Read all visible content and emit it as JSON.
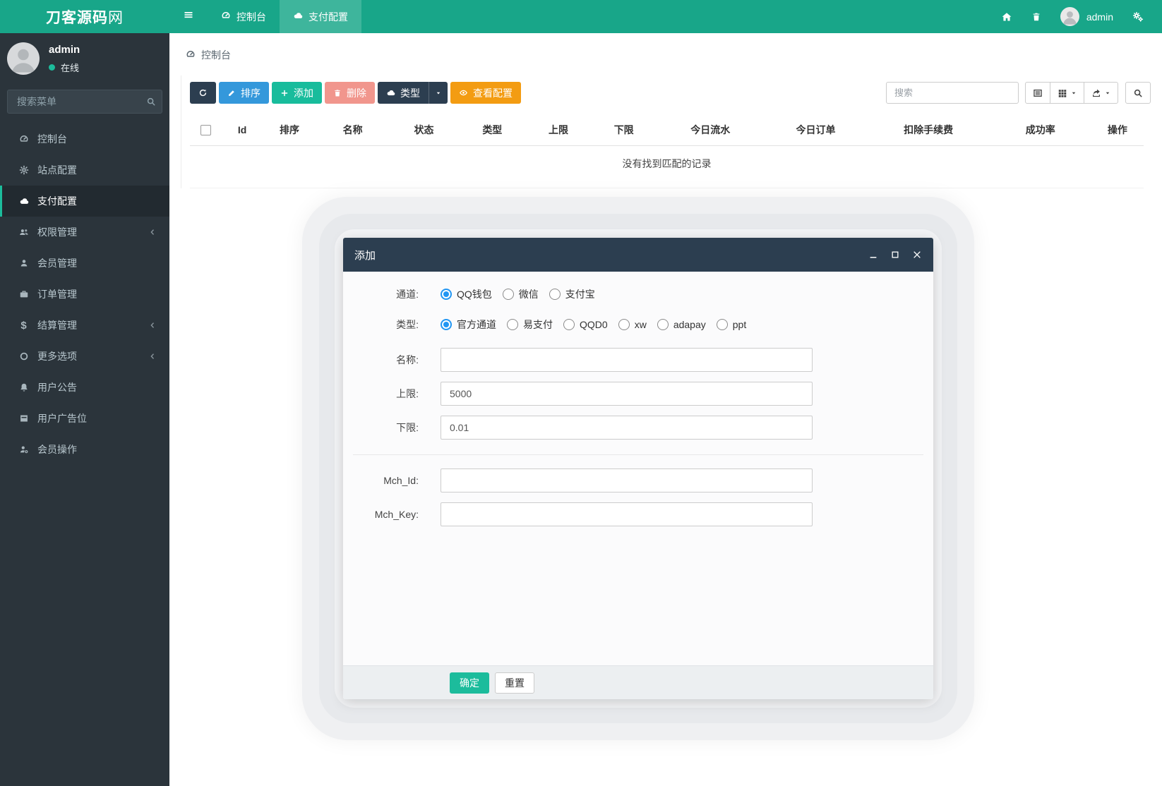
{
  "navbar": {
    "brand_bold": "刀客源码",
    "brand_light": "网",
    "tabs": [
      {
        "label": "控制台"
      },
      {
        "label": "支付配置"
      }
    ],
    "username": "admin"
  },
  "sidebar": {
    "username": "admin",
    "status": "在线",
    "search_placeholder": "搜索菜单",
    "items": [
      {
        "label": "控制台"
      },
      {
        "label": "站点配置"
      },
      {
        "label": "支付配置"
      },
      {
        "label": "权限管理"
      },
      {
        "label": "会员管理"
      },
      {
        "label": "订单管理"
      },
      {
        "label": "结算管理"
      },
      {
        "label": "更多选项"
      },
      {
        "label": "用户公告"
      },
      {
        "label": "用户广告位"
      },
      {
        "label": "会员操作"
      }
    ]
  },
  "breadcrumb": "控制台",
  "toolbar": {
    "sort_label": "排序",
    "add_label": "添加",
    "delete_label": "删除",
    "type_label": "类型",
    "view_config_label": "查看配置",
    "search_placeholder": "搜索"
  },
  "table": {
    "headers": [
      "Id",
      "排序",
      "名称",
      "状态",
      "类型",
      "上限",
      "下限",
      "今日流水",
      "今日订单",
      "扣除手续费",
      "成功率",
      "操作"
    ],
    "empty_text": "没有找到匹配的记录"
  },
  "modal": {
    "title": "添加",
    "channel": {
      "label": "通道:",
      "options": [
        "QQ钱包",
        "微信",
        "支付宝"
      ],
      "selected": "QQ钱包"
    },
    "type": {
      "label": "类型:",
      "options": [
        "官方通道",
        "易支付",
        "QQD0",
        "xw",
        "adapay",
        "ppt"
      ],
      "selected": "官方通道"
    },
    "name": {
      "label": "名称:",
      "value": ""
    },
    "upper": {
      "label": "上限:",
      "value": "5000"
    },
    "lower": {
      "label": "下限:",
      "value": "0.01"
    },
    "mch_id": {
      "label": "Mch_Id:",
      "value": ""
    },
    "mch_key": {
      "label": "Mch_Key:",
      "value": ""
    },
    "confirm_label": "确定",
    "reset_label": "重置"
  },
  "colors": {
    "navbar_teal": "#18A689",
    "sidebar_dark": "#2b343b",
    "primary_dark": "#2C3E50",
    "info_blue": "#3498DB",
    "success_teal": "#18BC9C",
    "danger_red": "#E74C3C",
    "warning_orange": "#F39C12",
    "radio_blue": "#2196F3",
    "online_dot": "#1CBC9C"
  }
}
